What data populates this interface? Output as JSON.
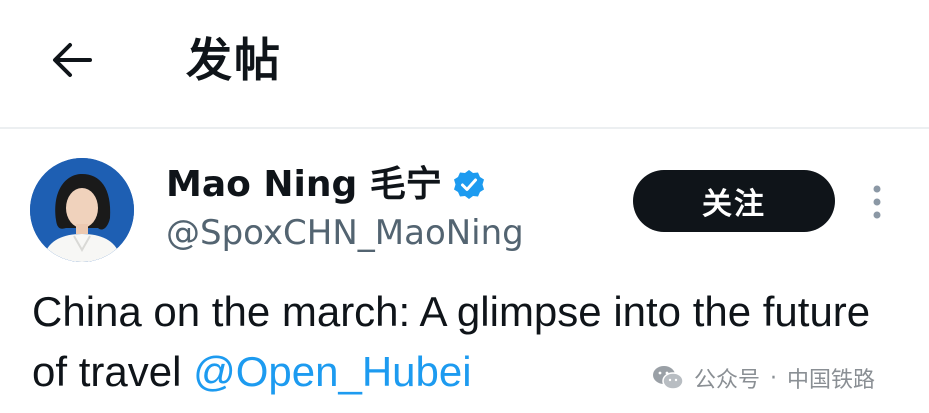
{
  "header": {
    "back_icon": "arrow-left-icon",
    "title": "发帖"
  },
  "post": {
    "author": {
      "display_name": "Mao Ning 毛宁",
      "handle": "@SpoxCHN_MaoNing",
      "verified_icon": "verified-badge-icon",
      "verified_color": "#1d9bf0",
      "avatar_background": "#1e5fb3"
    },
    "follow_label": "关注",
    "more_icon": "more-vertical-icon",
    "text_before": "China on the march: A glimpse into the future of travel ",
    "mention": "@Open_Hubei",
    "mention_color": "#1d9bf0"
  },
  "watermark": {
    "icon": "wechat-icon",
    "account_label": "公众号",
    "separator": "·",
    "account_name": "中国铁路"
  }
}
